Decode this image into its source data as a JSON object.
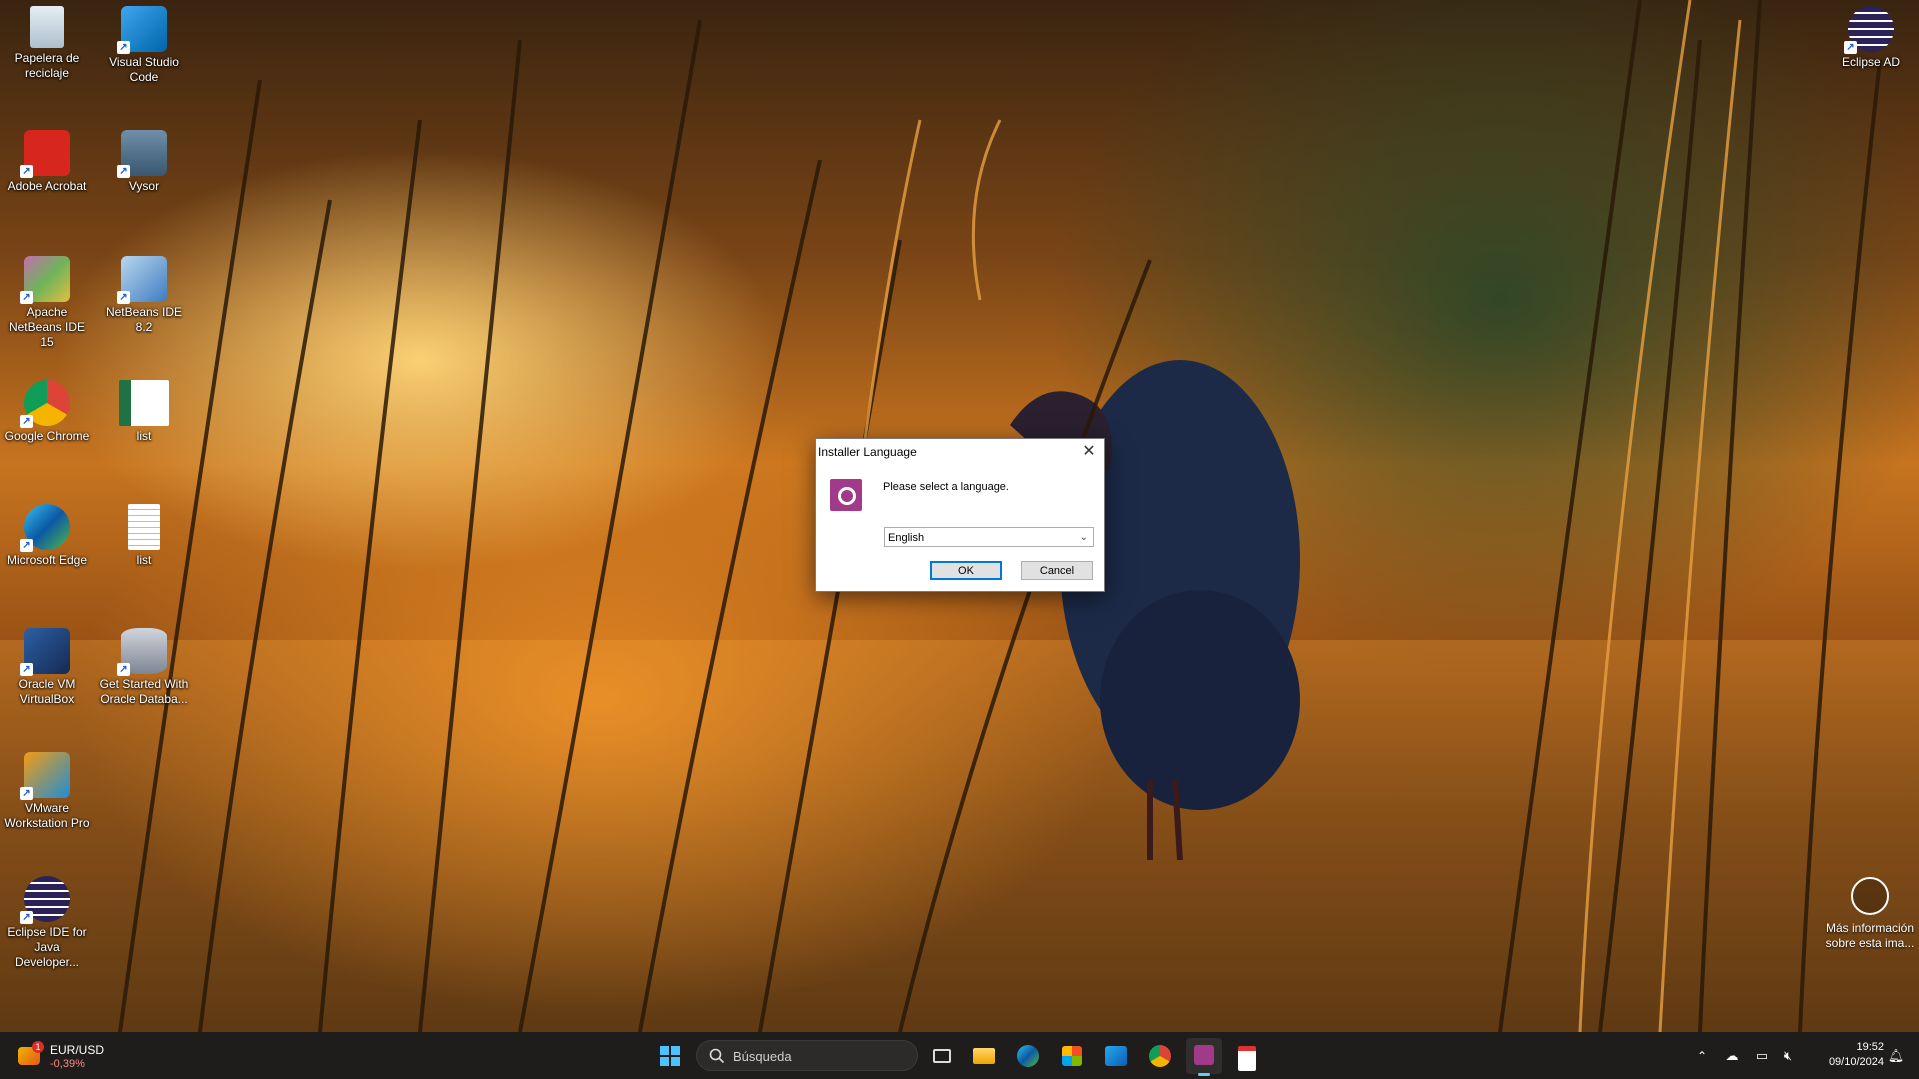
{
  "desktop": {
    "icons": [
      {
        "label": "Papelera de reciclaje",
        "icon": "recycle-bin-icon"
      },
      {
        "label": "Visual Studio Code",
        "icon": "vscode-icon"
      },
      {
        "label": "Adobe Acrobat",
        "icon": "acrobat-icon"
      },
      {
        "label": "Vysor",
        "icon": "vysor-icon"
      },
      {
        "label": "Apache NetBeans IDE 15",
        "icon": "netbeans-icon"
      },
      {
        "label": "NetBeans IDE 8.2",
        "icon": "netbeans-cube-icon"
      },
      {
        "label": "Google Chrome",
        "icon": "chrome-icon"
      },
      {
        "label": "list",
        "icon": "excel-file-icon"
      },
      {
        "label": "Microsoft Edge",
        "icon": "edge-icon"
      },
      {
        "label": "list",
        "icon": "text-file-icon"
      },
      {
        "label": "Oracle VM VirtualBox",
        "icon": "virtualbox-icon"
      },
      {
        "label": "Get Started With Oracle Databa...",
        "icon": "oracle-db-icon"
      },
      {
        "label": "VMware Workstation Pro",
        "icon": "vmware-icon"
      },
      {
        "label": "Eclipse IDE for Java Developer...",
        "icon": "eclipse-icon"
      },
      {
        "label": "Eclipse AD",
        "icon": "eclipse-icon"
      }
    ],
    "info_widget": {
      "label": "Más información sobre esta ima..."
    }
  },
  "dialog": {
    "title": "Installer Language",
    "message": "Please select a language.",
    "selected_language": "English",
    "ok_label": "OK",
    "cancel_label": "Cancel"
  },
  "taskbar": {
    "ticker_symbol": "EUR/USD",
    "ticker_change": "-0,39%",
    "ticker_badge": "1",
    "search_placeholder": "Búsqueda",
    "time": "19:52",
    "date": "09/10/2024"
  },
  "colors": {
    "taskbar_bg": "#1f1d1b",
    "accent": "#0078d7",
    "active_indicator": "#60cdff"
  }
}
